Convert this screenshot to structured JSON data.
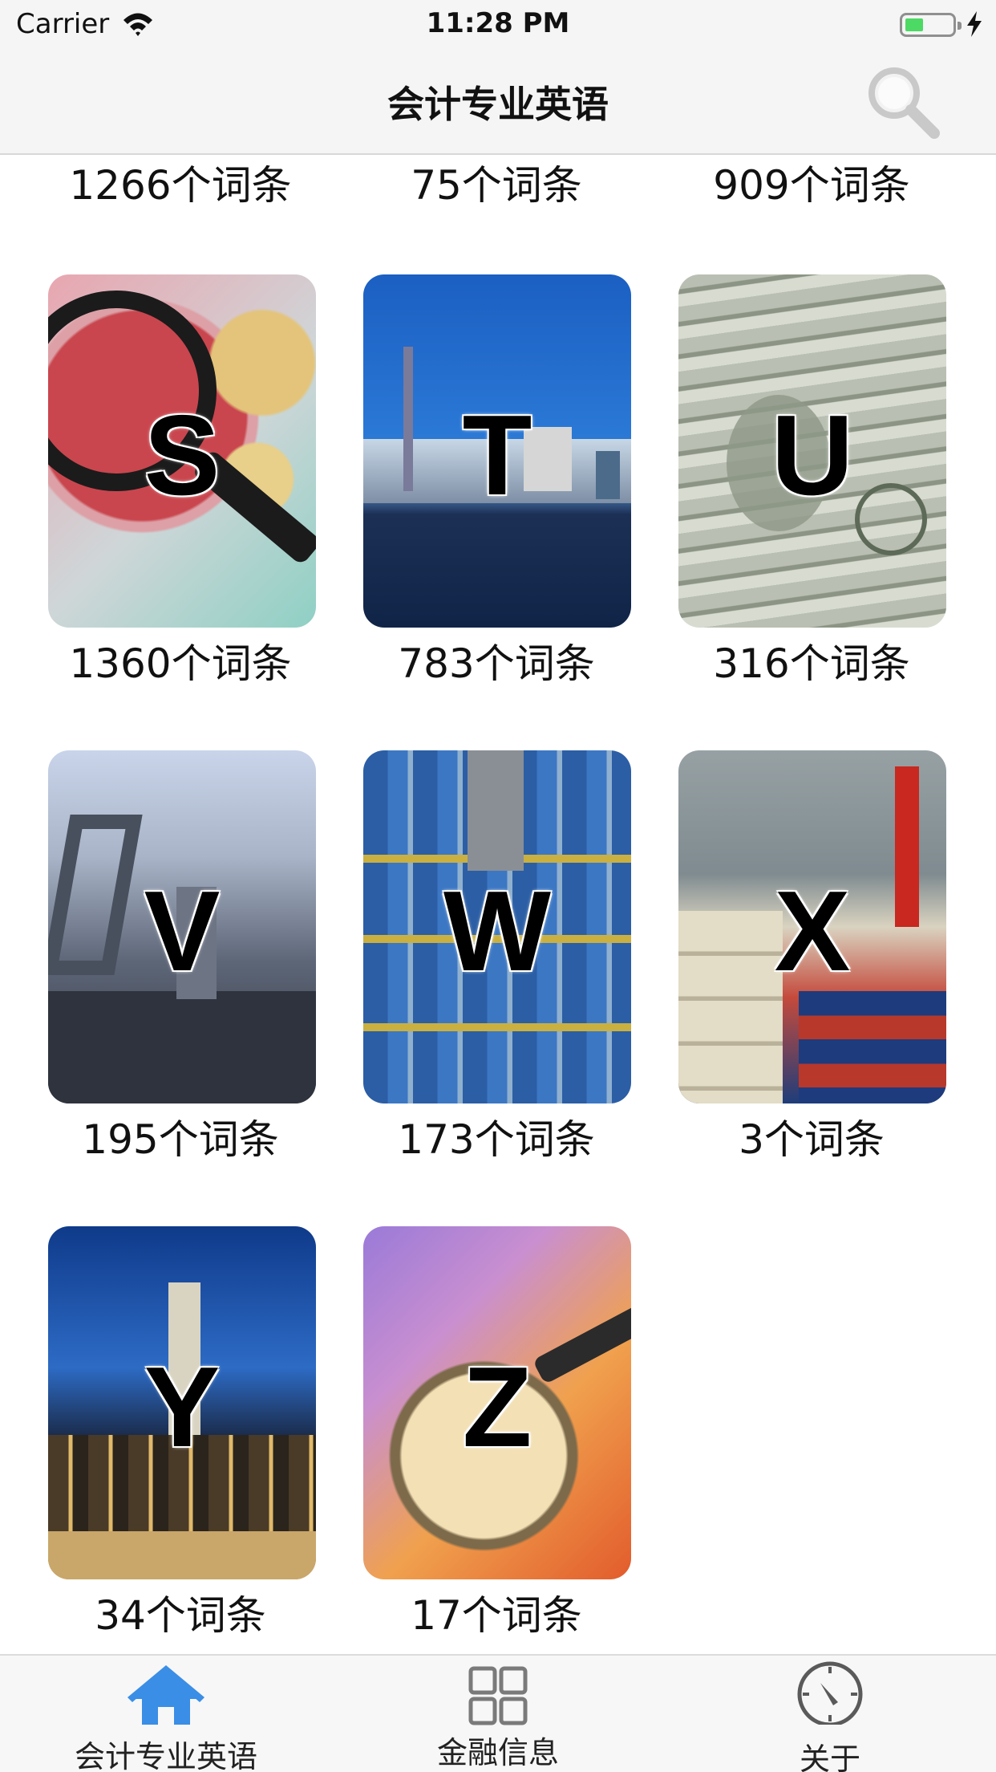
{
  "status_bar": {
    "carrier": "Carrier",
    "time": "11:28 PM"
  },
  "nav": {
    "title": "会计专业英语"
  },
  "top_counts": [
    "1266个词条",
    "75个词条",
    "909个词条"
  ],
  "cards": [
    {
      "letter": "S",
      "count": "1360个词条"
    },
    {
      "letter": "T",
      "count": "783个词条"
    },
    {
      "letter": "U",
      "count": "316个词条"
    },
    {
      "letter": "V",
      "count": "195个词条"
    },
    {
      "letter": "W",
      "count": "173个词条"
    },
    {
      "letter": "X",
      "count": "3个词条"
    },
    {
      "letter": "Y",
      "count": "34个词条"
    },
    {
      "letter": "Z",
      "count": "17个词条"
    }
  ],
  "tabs": [
    {
      "label": "会计专业英语",
      "icon": "home-icon",
      "active": true
    },
    {
      "label": "金融信息",
      "icon": "grid-icon",
      "active": false
    },
    {
      "label": "关于",
      "icon": "compass-icon",
      "active": false
    }
  ],
  "colors": {
    "accent": "#3a8ee6",
    "inactive_icon": "#7a7a7a",
    "battery": "#4cd964"
  }
}
